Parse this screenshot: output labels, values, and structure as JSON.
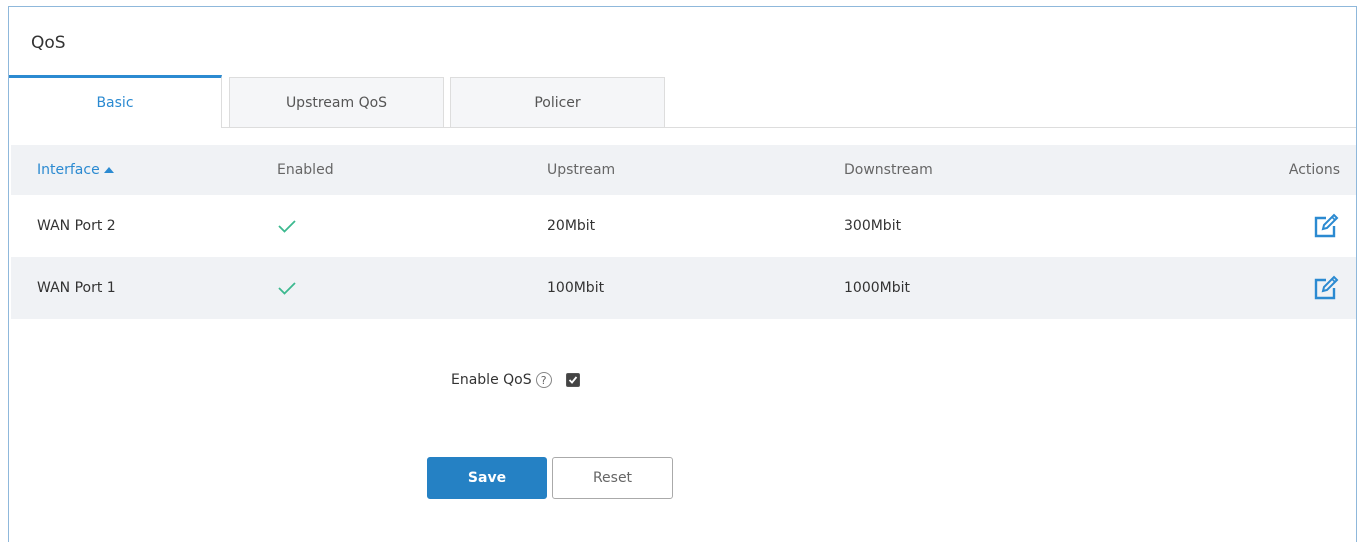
{
  "panel": {
    "title": "QoS"
  },
  "tabs": [
    {
      "label": "Basic",
      "active": true
    },
    {
      "label": "Upstream QoS",
      "active": false
    },
    {
      "label": "Policer",
      "active": false
    }
  ],
  "table": {
    "columns": {
      "interface": "Interface",
      "enabled": "Enabled",
      "upstream": "Upstream",
      "downstream": "Downstream",
      "actions": "Actions"
    },
    "sort": {
      "column": "interface",
      "direction": "ascending"
    },
    "rows": [
      {
        "interface": "WAN Port 2",
        "enabled": true,
        "upstream": "20Mbit",
        "downstream": "300Mbit",
        "action_icon": "edit-icon"
      },
      {
        "interface": "WAN Port 1",
        "enabled": true,
        "upstream": "100Mbit",
        "downstream": "1000Mbit",
        "action_icon": "edit-icon"
      }
    ]
  },
  "settings": {
    "enable_qos_label": "Enable QoS",
    "help_icon_glyph": "?",
    "enable_qos_checked": true
  },
  "buttons": {
    "save": "Save",
    "reset": "Reset"
  },
  "colors": {
    "accent": "#2b8ad1",
    "save_button": "#2581c4",
    "check": "#3cb98f",
    "header_bg": "#f0f2f5"
  }
}
